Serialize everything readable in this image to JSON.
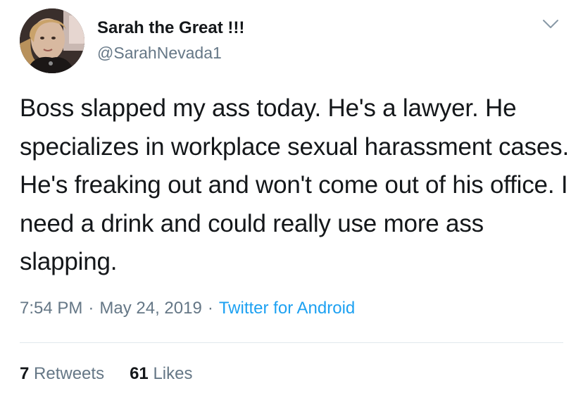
{
  "author": {
    "display_name": "Sarah the Great !!!",
    "handle": "@SarahNevada1"
  },
  "menu_icon": "chevron-down-icon",
  "tweet": {
    "text": "Boss slapped my ass today. He's a lawyer. He specializes in workplace sexual harassment cases. He's freaking out and won't come out of his office. I need a drink and could really use more ass slapping."
  },
  "meta": {
    "time": "7:54 PM",
    "separator": "·",
    "date": "May 24, 2019",
    "source": "Twitter for Android"
  },
  "stats": {
    "retweets_count": "7",
    "retweets_label": "Retweets",
    "likes_count": "61",
    "likes_label": "Likes"
  },
  "colors": {
    "text": "#14171a",
    "secondary": "#657786",
    "link": "#1da1f2",
    "divider": "#e1e8ed"
  }
}
